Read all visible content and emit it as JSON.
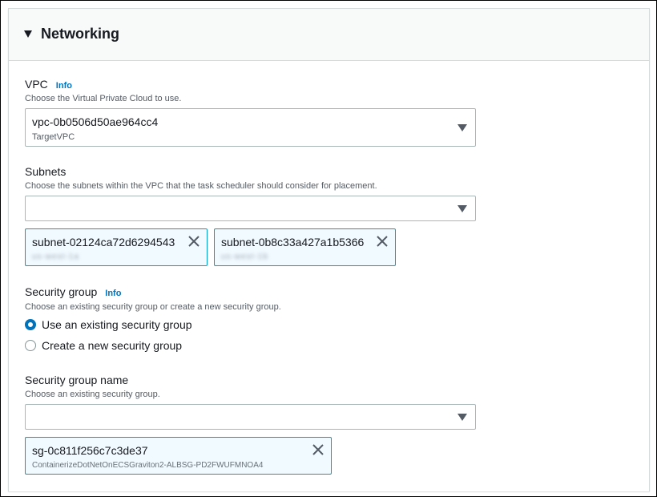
{
  "section": {
    "title": "Networking"
  },
  "vpc": {
    "label": "VPC",
    "info": "Info",
    "description": "Choose the Virtual Private Cloud to use.",
    "selected_id": "vpc-0b0506d50ae964cc4",
    "selected_name": "TargetVPC"
  },
  "subnets": {
    "label": "Subnets",
    "description": "Choose the subnets within the VPC that the task scheduler should consider for placement.",
    "tokens": [
      {
        "id": "subnet-02124ca72d6294543",
        "detail": "us-west-1a"
      },
      {
        "id": "subnet-0b8c33a427a1b5366",
        "detail": "us-west-1b"
      }
    ]
  },
  "security_group": {
    "label": "Security group",
    "info": "Info",
    "description": "Choose an existing security group or create a new security group.",
    "options": [
      {
        "label": "Use an existing security group",
        "selected": true
      },
      {
        "label": "Create a new security group",
        "selected": false
      }
    ]
  },
  "security_group_name": {
    "label": "Security group name",
    "description": "Choose an existing security group.",
    "tokens": [
      {
        "id": "sg-0c811f256c7c3de37",
        "detail": "ContainerizeDotNetOnECSGraviton2-ALBSG-PD2FWUFMNOA4"
      }
    ]
  },
  "colors": {
    "link": "#0073bb",
    "token_border": "#00a1c9",
    "token_bg": "#f1faff",
    "header_bg": "#f8f9f9"
  },
  "icons": {
    "expand": "caret-down-icon",
    "dropdown": "triangle-down-icon",
    "remove": "close-icon"
  }
}
